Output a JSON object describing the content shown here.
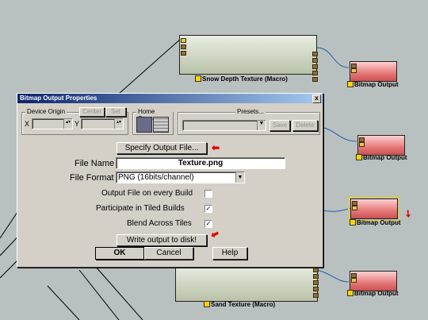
{
  "nodes": {
    "snow_macro": "Snow Depth Texture (Macro)",
    "sand_macro": "Sand Texture (Macro)",
    "out1": "Bitmap Output",
    "out2": "Bitmap Output",
    "out3": "Bitmap Output",
    "out4": "Bitmap Output"
  },
  "dialog": {
    "title": "Bitmap Output Properties",
    "close": "x",
    "device_origin": "Device Origin",
    "center": "Center",
    "set": "Set",
    "x_label": "X",
    "y_label": "Y",
    "home_space": "Home Space",
    "presets": "Presets...",
    "save": "Save",
    "delete": "Delete",
    "specify": "Specify Output File...",
    "file_name_label": "File Name",
    "file_name_value": "Texture.png",
    "file_format_label": "File Format",
    "file_format_value": "PNG (16bits/channel)",
    "every_build": "Output File on every Build",
    "tiled": "Participate in Tiled Builds",
    "blend": "Blend Across Tiles",
    "write": "Write output to disk!",
    "ok": "OK",
    "cancel": "Cancel",
    "help": "Help",
    "check_mark": "✓"
  },
  "accent": {
    "red": "#e00000",
    "node_red": "#e47878",
    "title_blue": "#0a246a"
  }
}
